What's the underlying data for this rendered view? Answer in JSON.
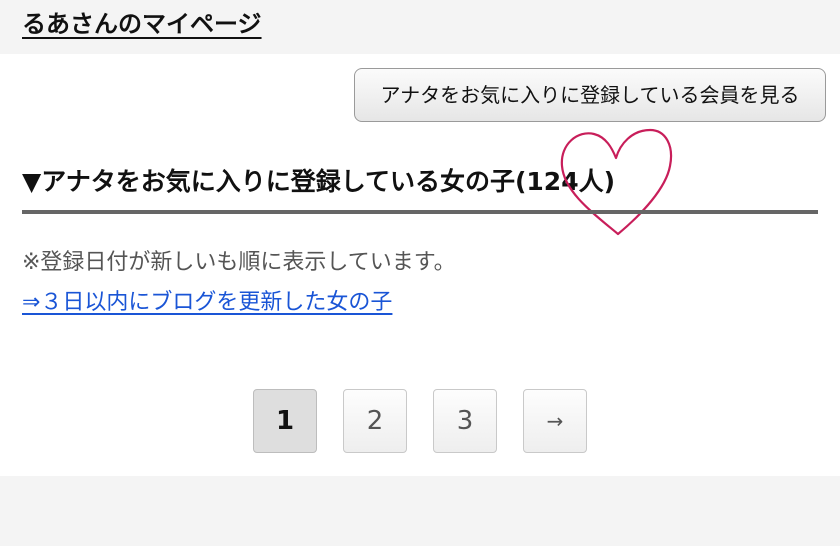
{
  "header": {
    "title": "るあさんのマイページ"
  },
  "favorites_button": {
    "label": "アナタをお気に入りに登録している会員を見る"
  },
  "section": {
    "heading": "▼アナタをお気に入りに登録している女の子(124人)",
    "note": "※登録日付が新しいも順に表示しています。",
    "blog_link": "⇒３日以内にブログを更新した女の子"
  },
  "pagination": {
    "pages": [
      "1",
      "2",
      "3"
    ],
    "current": "1",
    "next": "→"
  },
  "colors": {
    "link": "#1a55d6",
    "heart": "#c81e5a"
  },
  "icons": {
    "heart": "heart-doodle-icon"
  }
}
